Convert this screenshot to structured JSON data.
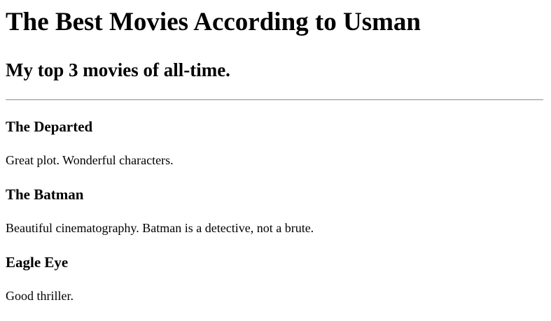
{
  "page": {
    "title": "The Best Movies According to Usman",
    "subtitle": "My top 3 movies of all-time."
  },
  "movies": [
    {
      "title": "The Departed",
      "description": "Great plot. Wonderful characters."
    },
    {
      "title": "The Batman",
      "description": "Beautiful cinematography. Batman is a detective, not a brute."
    },
    {
      "title": "Eagle Eye",
      "description": "Good thriller."
    }
  ]
}
